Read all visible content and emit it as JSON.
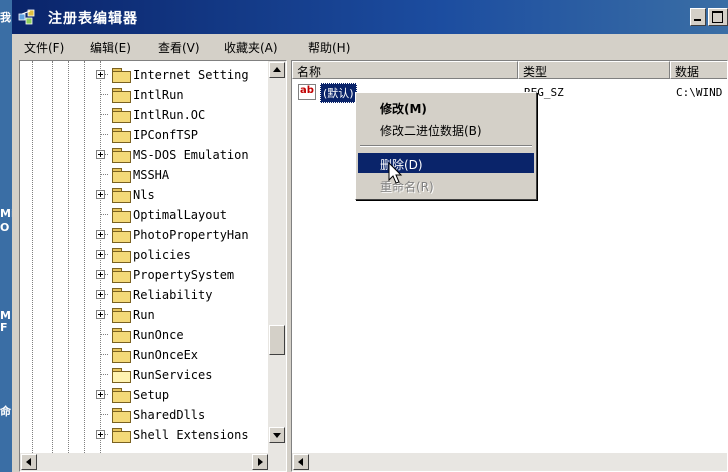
{
  "window": {
    "title": "注册表编辑器"
  },
  "desktop": {
    "labels": [
      "我",
      "Mi",
      "O",
      "M",
      "F",
      "命"
    ]
  },
  "menu": [
    "文件(F)",
    "编辑(E)",
    "查看(V)",
    "收藏夹(A)",
    "帮助(H)"
  ],
  "tree": {
    "items": [
      {
        "label": "Internet Setting",
        "expandable": true
      },
      {
        "label": "IntlRun",
        "expandable": false
      },
      {
        "label": "IntlRun.OC",
        "expandable": false
      },
      {
        "label": "IPConfTSP",
        "expandable": false
      },
      {
        "label": "MS-DOS Emulation",
        "expandable": true
      },
      {
        "label": "MSSHA",
        "expandable": false
      },
      {
        "label": "Nls",
        "expandable": true
      },
      {
        "label": "OptimalLayout",
        "expandable": false
      },
      {
        "label": "PhotoPropertyHan",
        "expandable": true
      },
      {
        "label": "policies",
        "expandable": true
      },
      {
        "label": "PropertySystem",
        "expandable": true
      },
      {
        "label": "Reliability",
        "expandable": true
      },
      {
        "label": "Run",
        "expandable": true
      },
      {
        "label": "RunOnce",
        "expandable": false
      },
      {
        "label": "RunOnceEx",
        "expandable": false
      },
      {
        "label": "RunServices",
        "expandable": false,
        "selected_folder": true
      },
      {
        "label": "Setup",
        "expandable": true
      },
      {
        "label": "SharedDlls",
        "expandable": false
      },
      {
        "label": "Shell Extensions",
        "expandable": true
      }
    ]
  },
  "list": {
    "columns": [
      "名称",
      "类型",
      "数据"
    ],
    "rows": [
      {
        "name": "(默认)",
        "type": "REG_SZ",
        "data": "C:\\WIND"
      }
    ]
  },
  "context_menu": {
    "items": [
      {
        "label": "修改(M)",
        "bold": true,
        "disabled": false
      },
      {
        "label": "修改二进位数据(B)",
        "bold": false,
        "disabled": false
      },
      {
        "label": "删除(D)",
        "bold": false,
        "disabled": false,
        "highlighted": true
      },
      {
        "label": "重命名(R)",
        "bold": false,
        "disabled": true
      }
    ]
  },
  "colors": {
    "title_bar": "#0a246a",
    "highlight": "#0a246a",
    "folder": "#f4d978",
    "disabled_text": "#808080"
  }
}
